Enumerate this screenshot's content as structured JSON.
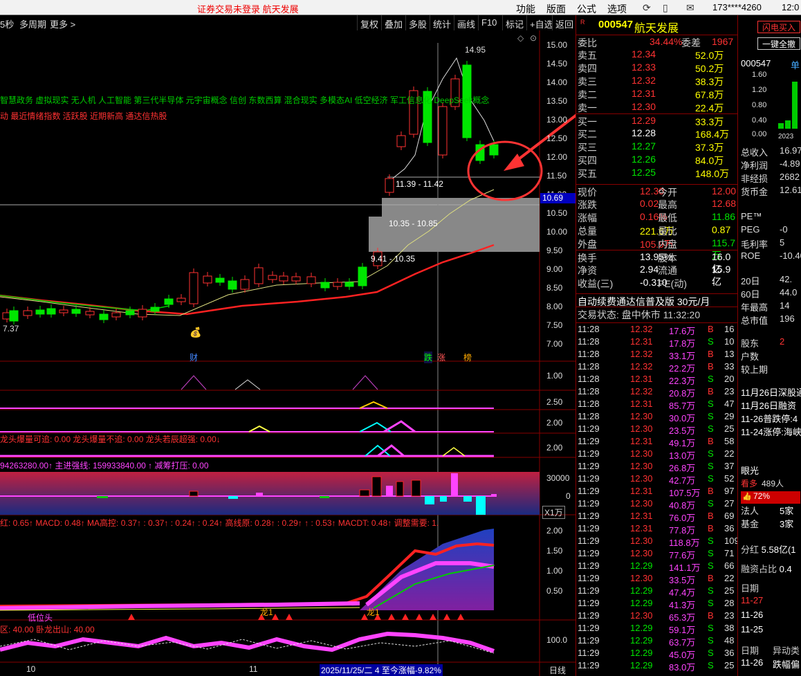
{
  "topbar": {
    "warning": "证券交易未登录  航天发展",
    "menus": [
      "功能",
      "版面",
      "公式",
      "选项"
    ],
    "account": "173****4260",
    "clock": "12:0"
  },
  "chartbar": {
    "period": "5秒",
    "multi": "多周期",
    "more": "更多 >",
    "buttons": [
      "复权",
      "叠加",
      "多股",
      "统计",
      "画线",
      "F10",
      "标记",
      "+自选",
      "返回"
    ]
  },
  "price_axis": [
    "15.00",
    "14.50",
    "14.00",
    "13.50",
    "13.00",
    "12.50",
    "12.00",
    "11.50",
    "11.00",
    "10.50",
    "10.00",
    "9.50",
    "9.00",
    "8.50",
    "8.00",
    "7.50",
    "7.00"
  ],
  "chart_labels": {
    "high": "14.95",
    "low_left": "7.37",
    "zone1": "11.39 - 11.42",
    "zone2": "10.35 - 10.85",
    "zone3": "9.41 - 10.35",
    "crosshair": "10.69",
    "events": [
      "财",
      "跌",
      "涨",
      "榜"
    ]
  },
  "concepts": {
    "line1": "智慧政务 虚拟现实 无人机 人工智能 第三代半导体 元宇宙概念 信创 东数西算 混合现实 多模态AI 低空经济 军工信息化 DeepSeek概念",
    "line2": "动 最近情绪指数 活跃股 近期新高 通达信热股"
  },
  "indicators": {
    "ind1": [
      "1.00"
    ],
    "ind2": [
      "2.50"
    ],
    "ind3": [
      "2.00"
    ],
    "ind4_text": "龙头爆量可追: 0.00  龙头爆量不追: 0.00  龙头若辰超强: 0.00↓",
    "ind4_axis": "2.00",
    "ind5_text": "94263280.00↑  主进强线: 159933840.00 ↑  减筹打压: 0.00",
    "ind5_axis": [
      "30000",
      "0"
    ],
    "ind5_unit": "X1万",
    "ind6_text": "红: 0.65↑  MACD: 0.48↑  MA高控: 0.37↑  : 0.37↑  : 0.24↑  : 0.24↑  高线原: 0.28↑  : 0.29↑     ↑  : 0.53↑  MACDT: 0.48↑  调整需要: 1.",
    "ind6_axis": [
      "2.00",
      "1.50",
      "1.00",
      "0.50"
    ],
    "ind7_text": "区: 40.00  卧龙出山: 40.00",
    "ind7_axis": "100.0",
    "ind6_labels": [
      "低位头",
      "龙1",
      "龙1"
    ]
  },
  "bottom_axis": {
    "left": "10",
    "mid": "11",
    "date": "2025/11/25/二  4 至今涨幅-9.82%",
    "period": "日线"
  },
  "quote": {
    "code": "000547",
    "name": "航天发展",
    "weibi_label": "委比",
    "weibi": "34.44%",
    "weicha_label": "委差",
    "weicha": "1967",
    "asks": [
      {
        "l": "卖五",
        "p": "12.34",
        "v": "52.0万"
      },
      {
        "l": "卖四",
        "p": "12.33",
        "v": "50.2万"
      },
      {
        "l": "卖三",
        "p": "12.32",
        "v": "38.3万"
      },
      {
        "l": "卖二",
        "p": "12.31",
        "v": "67.8万"
      },
      {
        "l": "卖一",
        "p": "12.30",
        "v": "22.4万"
      }
    ],
    "bids": [
      {
        "l": "买一",
        "p": "12.29",
        "v": "33.3万"
      },
      {
        "l": "买二",
        "p": "12.28",
        "v": "168.4万"
      },
      {
        "l": "买三",
        "p": "12.27",
        "v": "37.3万"
      },
      {
        "l": "买四",
        "p": "12.26",
        "v": "84.0万"
      },
      {
        "l": "买五",
        "p": "12.25",
        "v": "148.0万"
      }
    ],
    "stats": [
      [
        "现价",
        "12.30",
        "今开",
        "12.00"
      ],
      [
        "涨跌",
        "0.02",
        "最高",
        "12.68"
      ],
      [
        "涨幅",
        "0.16%",
        "最低",
        "11.86"
      ],
      [
        "总量",
        "221.6万",
        "量比",
        "0.87"
      ],
      [
        "外盘",
        "105.9万",
        "内盘",
        "115.7万"
      ],
      [
        "换手",
        "13.95%",
        "股本",
        "16.0亿"
      ],
      [
        "净资",
        "2.94",
        "流通",
        "15.9亿"
      ],
      [
        "收益(三)",
        "-0.310",
        "PE(动)",
        "-"
      ]
    ],
    "ad": "自动续费通达信普及版  30元/月",
    "status": "交易状态: 盘中休市 11:32:20"
  },
  "ticks": [
    [
      "11:28",
      "12.32",
      "17.6万",
      "B",
      "16"
    ],
    [
      "11:28",
      "12.31",
      "17.8万",
      "S",
      "10"
    ],
    [
      "11:28",
      "12.32",
      "33.1万",
      "B",
      "13"
    ],
    [
      "11:28",
      "12.32",
      "22.2万",
      "B",
      "33"
    ],
    [
      "11:28",
      "12.31",
      "22.3万",
      "S",
      "20"
    ],
    [
      "11:28",
      "12.32",
      "20.8万",
      "B",
      "23"
    ],
    [
      "11:28",
      "12.31",
      "85.7万",
      "S",
      "47"
    ],
    [
      "11:28",
      "12.30",
      "30.0万",
      "S",
      "29"
    ],
    [
      "11:29",
      "12.30",
      "23.5万",
      "S",
      "25"
    ],
    [
      "11:29",
      "12.31",
      "49.1万",
      "B",
      "58"
    ],
    [
      "11:29",
      "12.30",
      "13.0万",
      "S",
      "22"
    ],
    [
      "11:29",
      "12.30",
      "26.8万",
      "S",
      "37"
    ],
    [
      "11:29",
      "12.30",
      "42.7万",
      "S",
      "52"
    ],
    [
      "11:29",
      "12.31",
      "107.5万",
      "B",
      "97"
    ],
    [
      "11:29",
      "12.30",
      "40.8万",
      "S",
      "27"
    ],
    [
      "11:29",
      "12.31",
      "76.0万",
      "B",
      "69"
    ],
    [
      "11:29",
      "12.31",
      "77.8万",
      "B",
      "36"
    ],
    [
      "11:29",
      "12.30",
      "118.8万",
      "S",
      "109"
    ],
    [
      "11:29",
      "12.30",
      "77.6万",
      "S",
      "71"
    ],
    [
      "11:29",
      "12.29",
      "141.1万",
      "S",
      "66"
    ],
    [
      "11:29",
      "12.30",
      "33.5万",
      "B",
      "22"
    ],
    [
      "11:29",
      "12.29",
      "47.4万",
      "S",
      "25"
    ],
    [
      "11:29",
      "12.29",
      "41.3万",
      "S",
      "28"
    ],
    [
      "11:29",
      "12.30",
      "65.3万",
      "B",
      "23"
    ],
    [
      "11:29",
      "12.29",
      "59.1万",
      "S",
      "38"
    ],
    [
      "11:29",
      "12.29",
      "63.7万",
      "S",
      "48"
    ],
    [
      "11:29",
      "12.29",
      "45.0万",
      "S",
      "36"
    ],
    [
      "11:29",
      "12.29",
      "83.0万",
      "S",
      "25"
    ]
  ],
  "far": {
    "btn1": "闪电买入",
    "btn2": "一键全撤",
    "code": "000547",
    "tag": "单",
    "chart_y": [
      "1.60",
      "1.20",
      "0.80",
      "0.40",
      "0.00"
    ],
    "chart_x": "2023",
    "rows": [
      [
        "总收入",
        "16.97"
      ],
      [
        "净利润",
        "-4.89"
      ],
      [
        "非经损",
        "2682"
      ],
      [
        "货币金",
        "12.61"
      ]
    ],
    "rows2": [
      [
        "PE™",
        ""
      ],
      [
        "PEG",
        "-0"
      ],
      [
        "毛利率",
        "5"
      ],
      [
        "ROE",
        "-10.40"
      ]
    ],
    "rows3": [
      [
        "20日",
        "42."
      ],
      [
        "60日",
        "44.0"
      ],
      [
        "年最高",
        "14"
      ],
      [
        "总市值",
        "196"
      ]
    ],
    "rows4": [
      [
        "股东",
        "2"
      ],
      [
        "户数",
        ""
      ],
      [
        "较上期",
        ""
      ]
    ],
    "news": [
      "11月26日深股通",
      "11月26日融资",
      "11-26普跌停:4",
      "11-24涨停:海峡"
    ],
    "eye": "眼光",
    "eye_count": "489人",
    "eye_label": "看多",
    "pct": "72%",
    "inst": [
      [
        "法人",
        "5家"
      ],
      [
        "基金",
        "3家"
      ]
    ],
    "fenhong": [
      "分红",
      "5.58亿(1"
    ],
    "rzzb": [
      "融资占比",
      "0.4"
    ],
    "dates_head": "日期",
    "dates": [
      "11-27",
      "11-26",
      "11-25"
    ],
    "foot": [
      "日期",
      "异动类"
    ],
    "foot2": [
      "11-26",
      "跌幅偏"
    ]
  }
}
